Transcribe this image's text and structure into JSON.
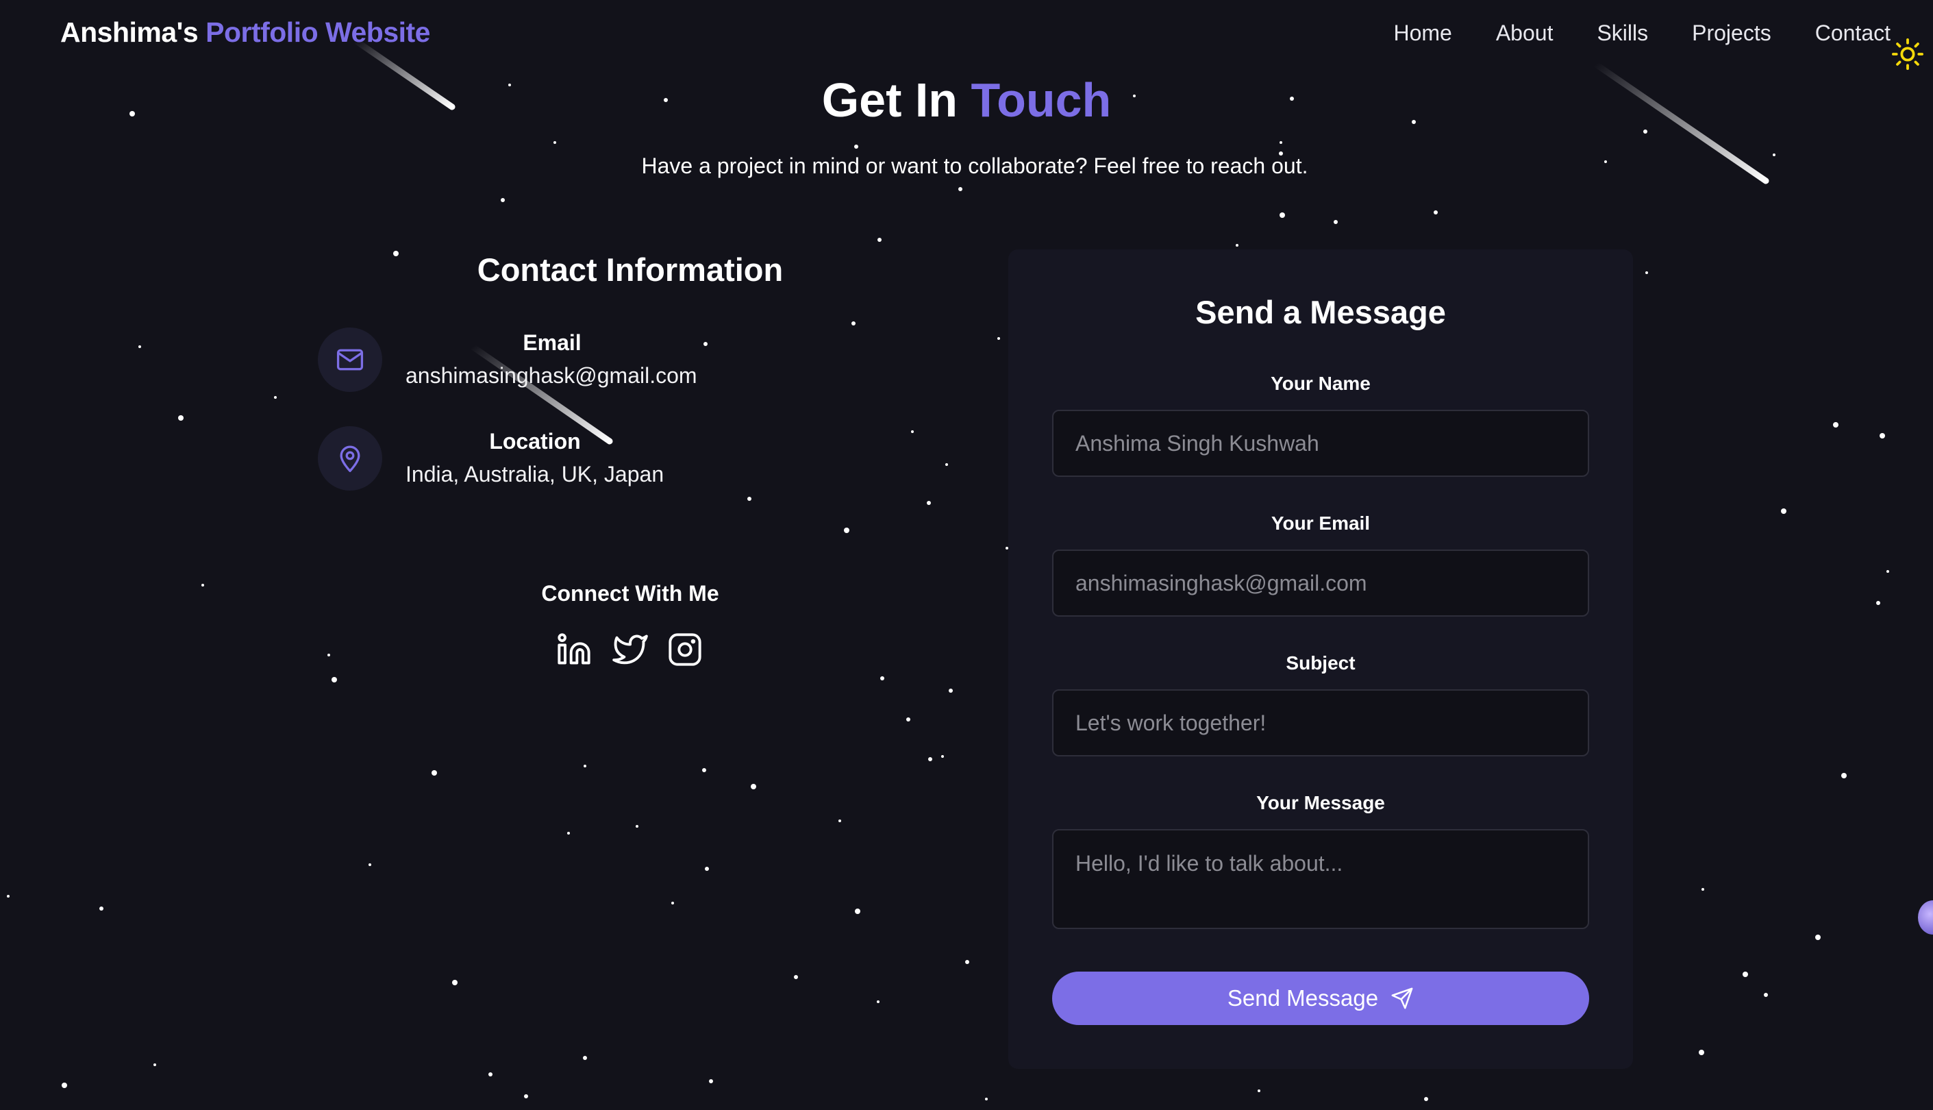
{
  "nav": {
    "logo_owner": "Anshima's",
    "logo_accent": "Portfolio Website",
    "links": [
      "Home",
      "About",
      "Skills",
      "Projects",
      "Contact"
    ],
    "theme_toggle_icon": "sun-icon"
  },
  "hero": {
    "title_plain": "Get In",
    "title_accent": "Touch",
    "subtitle": "Have a project in mind or want to collaborate? Feel free to reach out."
  },
  "contact_info": {
    "title": "Contact Information",
    "email": {
      "label": "Email",
      "value": "anshimasinghask@gmail.com",
      "icon": "mail-icon"
    },
    "location": {
      "label": "Location",
      "value": "India, Australia, UK, Japan",
      "icon": "map-pin-icon"
    },
    "connect_title": "Connect With Me",
    "socials": [
      "linkedin-icon",
      "twitter-icon",
      "instagram-icon"
    ]
  },
  "form": {
    "title": "Send a Message",
    "name_label": "Your Name",
    "name_placeholder": "Anshima Singh Kushwah",
    "email_label": "Your Email",
    "email_placeholder": "anshimasinghask@gmail.com",
    "subject_label": "Subject",
    "subject_placeholder": "Let's work together!",
    "message_label": "Your Message",
    "message_placeholder": "Hello, I'd like to talk about...",
    "submit_label": "Send Message",
    "submit_icon": "send-icon"
  },
  "colors": {
    "background": "#12121a",
    "accent": "#7c6ee6",
    "card": "#161622",
    "input_bg": "#101017"
  }
}
